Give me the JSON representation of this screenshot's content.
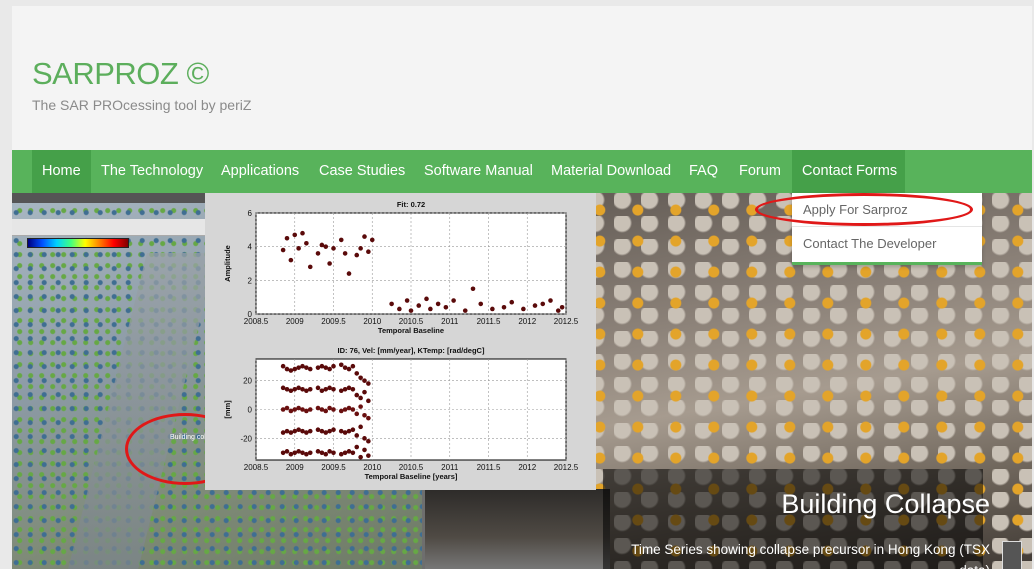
{
  "site": {
    "title": "SARPROZ ©",
    "tagline": "The SAR PROcessing tool by periZ"
  },
  "nav": {
    "items": [
      {
        "label": "Home"
      },
      {
        "label": "The Technology"
      },
      {
        "label": "Applications"
      },
      {
        "label": "Case Studies"
      },
      {
        "label": "Software Manual"
      },
      {
        "label": "Material Download"
      },
      {
        "label": "FAQ"
      },
      {
        "label": "Forum"
      },
      {
        "label": "Contact Forms"
      }
    ],
    "active": "Home",
    "open_menu": "Contact Forms"
  },
  "dropdown": {
    "items": [
      {
        "label": "Apply For Sarproz"
      },
      {
        "label": "Contact The Developer"
      }
    ],
    "highlighted": "Apply For Sarproz",
    "annotation_color": "#e01818"
  },
  "slider": {
    "title": "Building Collapse",
    "caption": "Time Series showing collapse precursor in Hong Kong (TSX data)",
    "map_label": "Building coll"
  },
  "colors": {
    "brand": "#5cae5c",
    "navbar": "#58b35b",
    "nav_active": "#45a049",
    "annotation": "#e01818"
  },
  "chart_data": [
    {
      "type": "scatter",
      "title": "Fit: 0.72",
      "xlabel": "Temporal Baseline",
      "ylabel": "Amplitude",
      "xlim": [
        2008.5,
        2012.5
      ],
      "ylim": [
        0,
        6
      ],
      "xticks": [
        "2008.5",
        "2009",
        "2009.5",
        "2010",
        "2010.5",
        "2011",
        "2011.5",
        "2012",
        "2012.5"
      ],
      "yticks": [
        "0",
        "2",
        "4",
        "6"
      ],
      "series": [
        {
          "values_x": [
            2008.85,
            2008.9,
            2008.95,
            2009.0,
            2009.05,
            2009.1,
            2009.15,
            2009.2,
            2009.3,
            2009.35,
            2009.4,
            2009.45,
            2009.5,
            2009.6,
            2009.65,
            2009.7,
            2009.8,
            2009.85,
            2009.9,
            2009.95,
            2010.0,
            2010.25,
            2010.35,
            2010.45,
            2010.5,
            2010.6,
            2010.7,
            2010.75,
            2010.85,
            2010.95,
            2011.05,
            2011.2,
            2011.3,
            2011.4,
            2011.55,
            2011.7,
            2011.8,
            2011.95,
            2012.1,
            2012.2,
            2012.3,
            2012.4,
            2012.45
          ],
          "values_y": [
            3.8,
            4.5,
            3.2,
            4.7,
            3.9,
            4.8,
            4.2,
            2.8,
            3.6,
            4.1,
            4.0,
            3.0,
            3.9,
            4.4,
            3.6,
            2.4,
            3.5,
            3.9,
            4.6,
            3.7,
            4.4,
            0.6,
            0.3,
            0.8,
            0.2,
            0.5,
            0.9,
            0.3,
            0.6,
            0.4,
            0.8,
            0.2,
            1.5,
            0.6,
            0.3,
            0.4,
            0.7,
            0.3,
            0.5,
            0.6,
            0.8,
            0.2,
            0.4
          ]
        }
      ]
    },
    {
      "type": "scatter",
      "title": "ID: 76, Vel:  [mm/year], KTemp:  [rad/degC]",
      "xlabel": "Temporal Baseline [years]",
      "ylabel": "[mm]",
      "xlim": [
        2008.5,
        2012.5
      ],
      "ylim": [
        -35,
        35
      ],
      "xticks": [
        "2008.5",
        "2009",
        "2009.5",
        "2010",
        "2010.5",
        "2011",
        "2011.5",
        "2012",
        "2012.5"
      ],
      "yticks": [
        "20",
        "0",
        "-20"
      ],
      "series": [
        {
          "values_x": [
            2008.85,
            2008.9,
            2008.95,
            2009.0,
            2009.05,
            2009.1,
            2009.15,
            2009.2,
            2009.3,
            2009.35,
            2009.4,
            2009.45,
            2009.5,
            2009.6,
            2009.65,
            2009.7,
            2009.75,
            2009.8,
            2009.85,
            2009.9,
            2009.95
          ],
          "values_y": [
            30,
            28,
            27,
            28,
            29,
            30,
            29,
            28,
            29,
            30,
            29,
            28,
            30,
            31,
            29,
            28,
            30,
            25,
            22,
            20,
            18
          ]
        },
        {
          "values_x": [
            2008.85,
            2008.9,
            2008.95,
            2009.0,
            2009.05,
            2009.1,
            2009.15,
            2009.2,
            2009.3,
            2009.35,
            2009.4,
            2009.45,
            2009.5,
            2009.6,
            2009.65,
            2009.7,
            2009.75,
            2009.8,
            2009.85,
            2009.9,
            2009.95
          ],
          "values_y": [
            15,
            14,
            13,
            14,
            15,
            14,
            13,
            14,
            15,
            13,
            14,
            15,
            14,
            13,
            14,
            15,
            14,
            10,
            8,
            12,
            6
          ]
        },
        {
          "values_x": [
            2008.85,
            2008.9,
            2008.95,
            2009.0,
            2009.05,
            2009.1,
            2009.15,
            2009.2,
            2009.3,
            2009.35,
            2009.4,
            2009.45,
            2009.5,
            2009.6,
            2009.65,
            2009.7,
            2009.75,
            2009.8,
            2009.85,
            2009.9,
            2009.95
          ],
          "values_y": [
            0,
            1,
            -1,
            0,
            1,
            0,
            -1,
            0,
            1,
            0,
            -1,
            1,
            0,
            -1,
            0,
            1,
            0,
            -3,
            2,
            -4,
            -6
          ]
        },
        {
          "values_x": [
            2008.85,
            2008.9,
            2008.95,
            2009.0,
            2009.05,
            2009.1,
            2009.15,
            2009.2,
            2009.3,
            2009.35,
            2009.4,
            2009.45,
            2009.5,
            2009.6,
            2009.65,
            2009.7,
            2009.75,
            2009.8,
            2009.85,
            2009.9,
            2009.95
          ],
          "values_y": [
            -16,
            -15,
            -16,
            -15,
            -14,
            -15,
            -16,
            -15,
            -14,
            -15,
            -16,
            -15,
            -14,
            -15,
            -16,
            -15,
            -14,
            -18,
            -12,
            -20,
            -22
          ]
        },
        {
          "values_x": [
            2008.85,
            2008.9,
            2008.95,
            2009.0,
            2009.05,
            2009.1,
            2009.15,
            2009.2,
            2009.3,
            2009.35,
            2009.4,
            2009.45,
            2009.5,
            2009.6,
            2009.65,
            2009.7,
            2009.75,
            2009.8,
            2009.85,
            2009.9,
            2009.95
          ],
          "values_y": [
            -30,
            -29,
            -31,
            -30,
            -29,
            -30,
            -31,
            -30,
            -29,
            -30,
            -31,
            -29,
            -30,
            -31,
            -30,
            -29,
            -30,
            -26,
            -33,
            -28,
            -32
          ]
        }
      ]
    }
  ]
}
